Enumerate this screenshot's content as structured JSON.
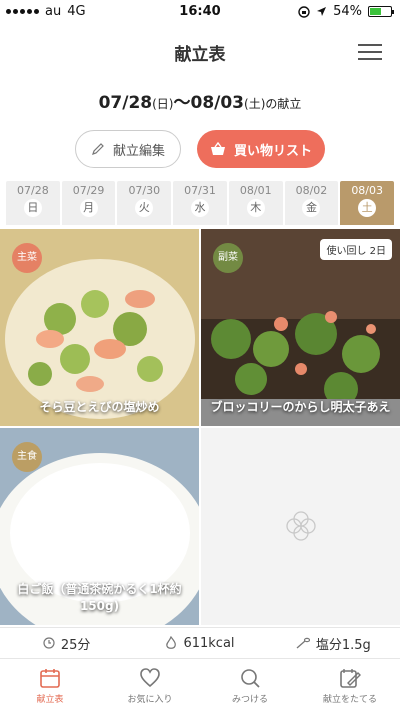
{
  "status": {
    "carrier": "au",
    "network": "4G",
    "time": "16:40",
    "battery": "54%"
  },
  "header": {
    "title": "献立表"
  },
  "date_range": {
    "start": "07/28",
    "start_day": "(日)",
    "sep": "〜",
    "end": "08/03",
    "end_day": "(土)",
    "suffix": "の献立"
  },
  "buttons": {
    "edit": "献立編集",
    "shopping": "買い物リスト"
  },
  "days": [
    {
      "date": "07/28",
      "weekday": "日"
    },
    {
      "date": "07/29",
      "weekday": "月"
    },
    {
      "date": "07/30",
      "weekday": "火"
    },
    {
      "date": "07/31",
      "weekday": "水"
    },
    {
      "date": "08/01",
      "weekday": "木"
    },
    {
      "date": "08/02",
      "weekday": "金"
    },
    {
      "date": "08/03",
      "weekday": "土"
    }
  ],
  "selected_day_index": 6,
  "dishes": [
    {
      "tag": "主菜",
      "name": "そら豆とえびの塩炒め"
    },
    {
      "tag": "副菜",
      "name": "ブロッコリーのからし明太子あえ",
      "badge": "使い回し 2日"
    },
    {
      "tag": "主食",
      "name": "白ご飯（普通茶碗かるく1杯約150g)"
    }
  ],
  "stats": {
    "time": "25分",
    "calories": "611kcal",
    "salt": "塩分1.5g"
  },
  "tabbar": [
    {
      "label": "献立表",
      "icon": "calendar-icon"
    },
    {
      "label": "お気に入り",
      "icon": "heart-icon"
    },
    {
      "label": "みつける",
      "icon": "search-icon"
    },
    {
      "label": "献立をたてる",
      "icon": "edit-note-icon"
    }
  ],
  "colors": {
    "accent": "#ee6e5c",
    "selected_day": "#b99a6b",
    "tab_active": "#e36b53"
  }
}
